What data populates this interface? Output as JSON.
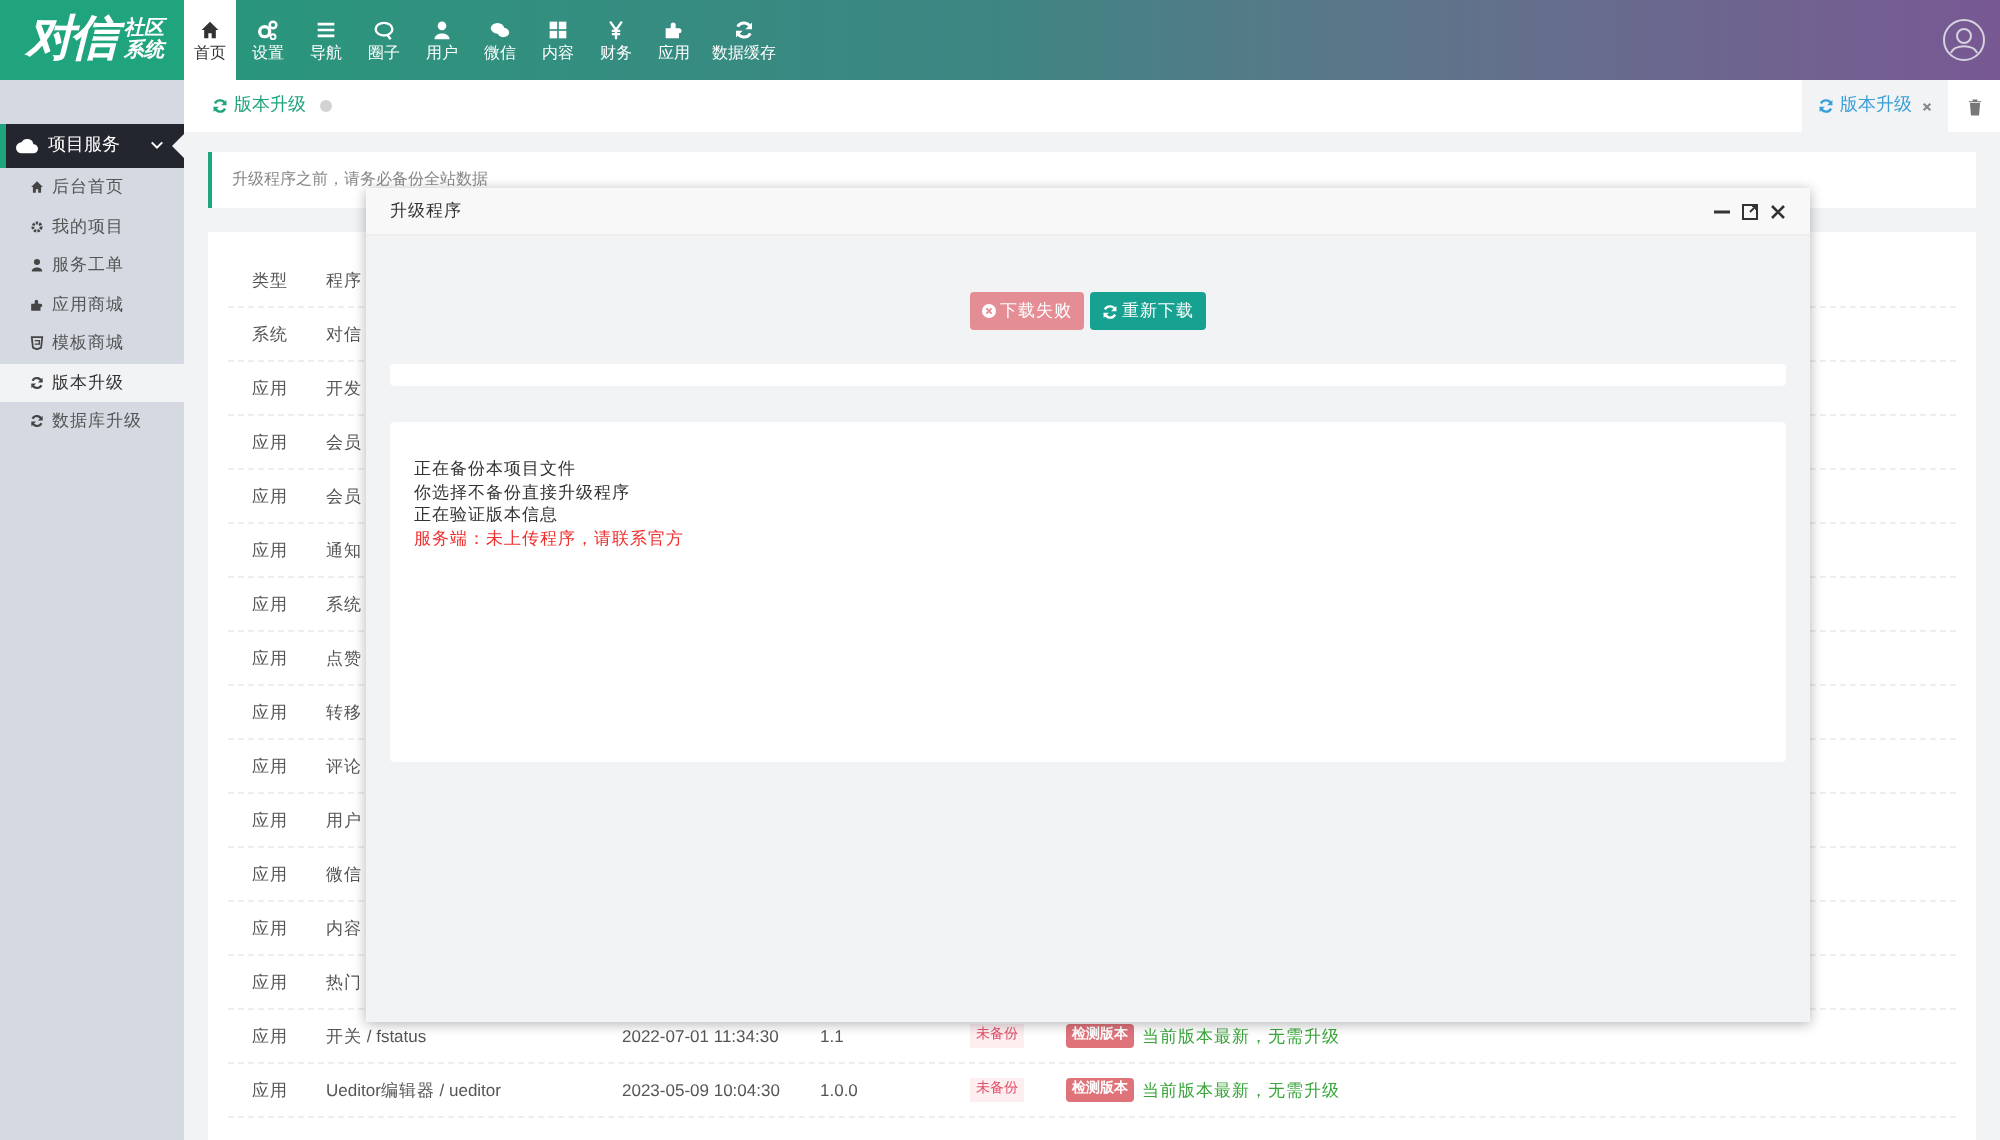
{
  "header": {
    "logo": {
      "main": "对信",
      "sub_top": "社区",
      "sub_bottom": "系统"
    },
    "nav": [
      {
        "label": "首页",
        "selected": true
      },
      {
        "label": "设置",
        "selected": false
      },
      {
        "label": "导航",
        "selected": false
      },
      {
        "label": "圈子",
        "selected": false
      },
      {
        "label": "用户",
        "selected": false
      },
      {
        "label": "微信",
        "selected": false
      },
      {
        "label": "内容",
        "selected": false
      },
      {
        "label": "财务",
        "selected": false
      },
      {
        "label": "应用",
        "selected": false
      },
      {
        "label": "数据缓存",
        "selected": false
      }
    ]
  },
  "sidebar": {
    "group": {
      "label": "项目服务",
      "expanded": true
    },
    "items": [
      {
        "label": "后台首页",
        "selected": false
      },
      {
        "label": "我的项目",
        "selected": false
      },
      {
        "label": "服务工单",
        "selected": false
      },
      {
        "label": "应用商城",
        "selected": false
      },
      {
        "label": "模板商城",
        "selected": false
      },
      {
        "label": "版本升级",
        "selected": true
      },
      {
        "label": "数据库升级",
        "selected": false
      }
    ]
  },
  "tabs": {
    "breadcrumb": "版本升级",
    "open_tabs": [
      {
        "label": "版本升级",
        "selected": true
      }
    ]
  },
  "notice": "升级程序之前，请务必备份全站数据",
  "table": {
    "columns": [
      "类型",
      "程序"
    ],
    "rows": [
      {
        "type": "系统",
        "name": "对信"
      },
      {
        "type": "应用",
        "name": "开发"
      },
      {
        "type": "应用",
        "name": "会员"
      },
      {
        "type": "应用",
        "name": "会员"
      },
      {
        "type": "应用",
        "name": "通知"
      },
      {
        "type": "应用",
        "name": "系统"
      },
      {
        "type": "应用",
        "name": "点赞"
      },
      {
        "type": "应用",
        "name": "转移"
      },
      {
        "type": "应用",
        "name": "评论"
      },
      {
        "type": "应用",
        "name": "用户"
      },
      {
        "type": "应用",
        "name": "微信"
      },
      {
        "type": "应用",
        "name": "内容"
      },
      {
        "type": "应用",
        "name": "热门"
      },
      {
        "type": "应用",
        "name": "开关 / fstatus",
        "time": "2022-07-01 11:34:30",
        "version": "1.1",
        "backup": "未备份",
        "check": "检测版本",
        "result": "当前版本最新，无需升级"
      },
      {
        "type": "应用",
        "name": "Ueditor编辑器 / ueditor",
        "time": "2023-05-09 10:04:30",
        "version": "1.0.0",
        "backup": "未备份",
        "check": "检测版本",
        "result": "当前版本最新，无需升级"
      }
    ]
  },
  "modal": {
    "title": "升级程序",
    "progress": {
      "level": 0
    },
    "buttons": [
      {
        "label": "下载失败",
        "kind": "failed"
      },
      {
        "label": "重新下载",
        "kind": "retry"
      }
    ],
    "log": [
      {
        "text": "正在备份本项目文件",
        "kind": "info"
      },
      {
        "text": "你选择不备份直接升级程序",
        "kind": "info"
      },
      {
        "text": "正在验证版本信息",
        "kind": "info"
      },
      {
        "text": "服务端：未上传程序，请联系官方",
        "kind": "error"
      }
    ]
  }
}
